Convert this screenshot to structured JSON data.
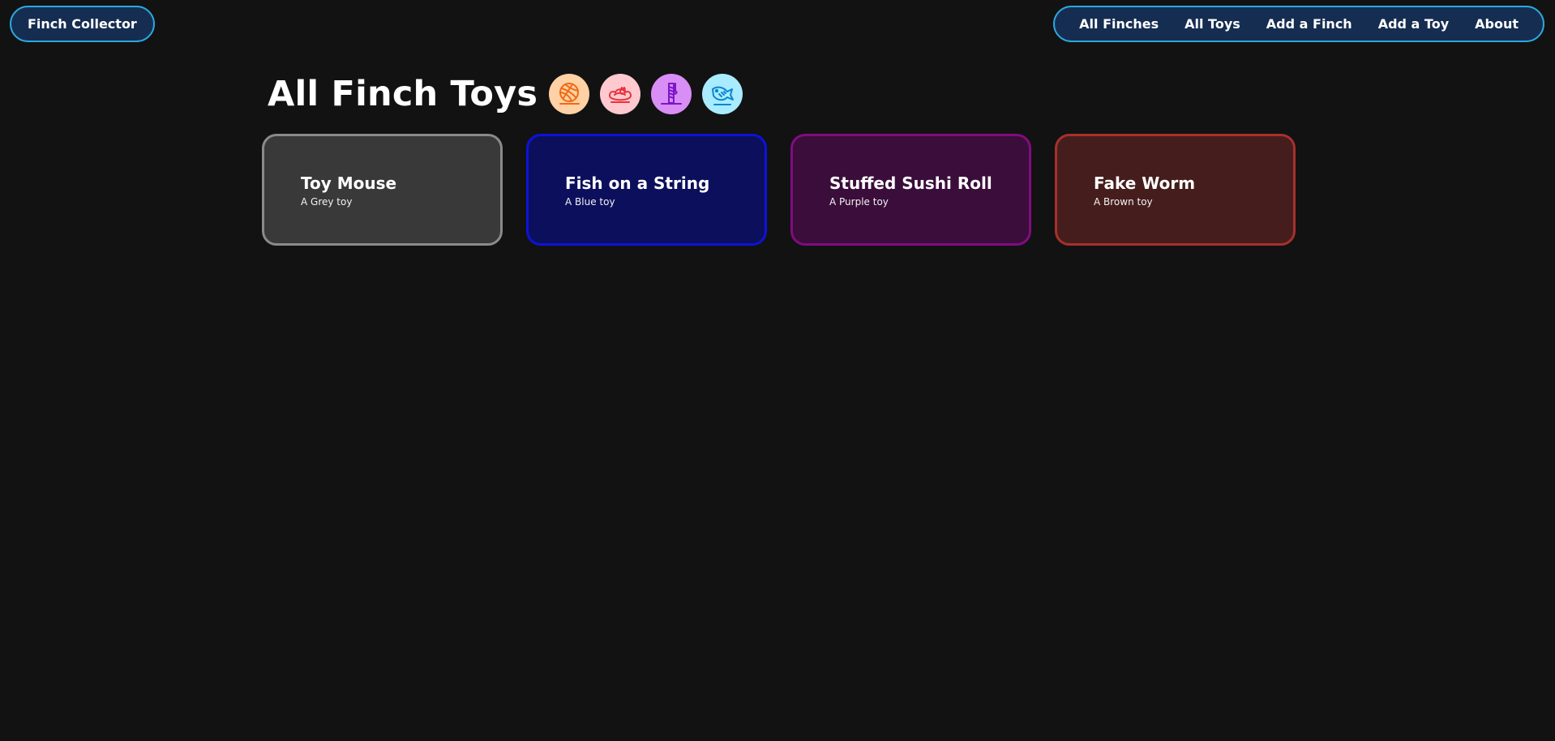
{
  "header": {
    "brand_label": "Finch Collector",
    "nav": [
      {
        "label": "All Finches"
      },
      {
        "label": "All Toys"
      },
      {
        "label": "Add a Finch"
      },
      {
        "label": "Add a Toy"
      },
      {
        "label": "About"
      }
    ]
  },
  "main": {
    "title": "All Finch Toys",
    "title_icons": [
      {
        "name": "yarn-ball-icon",
        "bg": "#ffd1a4",
        "fg": "#f06a14"
      },
      {
        "name": "cat-bed-icon",
        "bg": "#ffc9cf",
        "fg": "#e8333d"
      },
      {
        "name": "scratching-post-icon",
        "bg": "#d98ef5",
        "fg": "#7b16c9"
      },
      {
        "name": "fish-toy-icon",
        "bg": "#a9ecff",
        "fg": "#0a86d1"
      }
    ],
    "toys": [
      {
        "name": "Toy Mouse",
        "description": "A Grey toy",
        "bg": "#393939",
        "border": "#8a8a8a"
      },
      {
        "name": "Fish on a String",
        "description": "A Blue toy",
        "bg": "#0c0f5c",
        "border": "#0d13d6"
      },
      {
        "name": "Stuffed Sushi Roll",
        "description": "A Purple toy",
        "bg": "#3a0d3a",
        "border": "#800c80"
      },
      {
        "name": "Fake Worm",
        "description": "A Brown toy",
        "bg": "#461d1d",
        "border": "#a7302c"
      }
    ]
  }
}
